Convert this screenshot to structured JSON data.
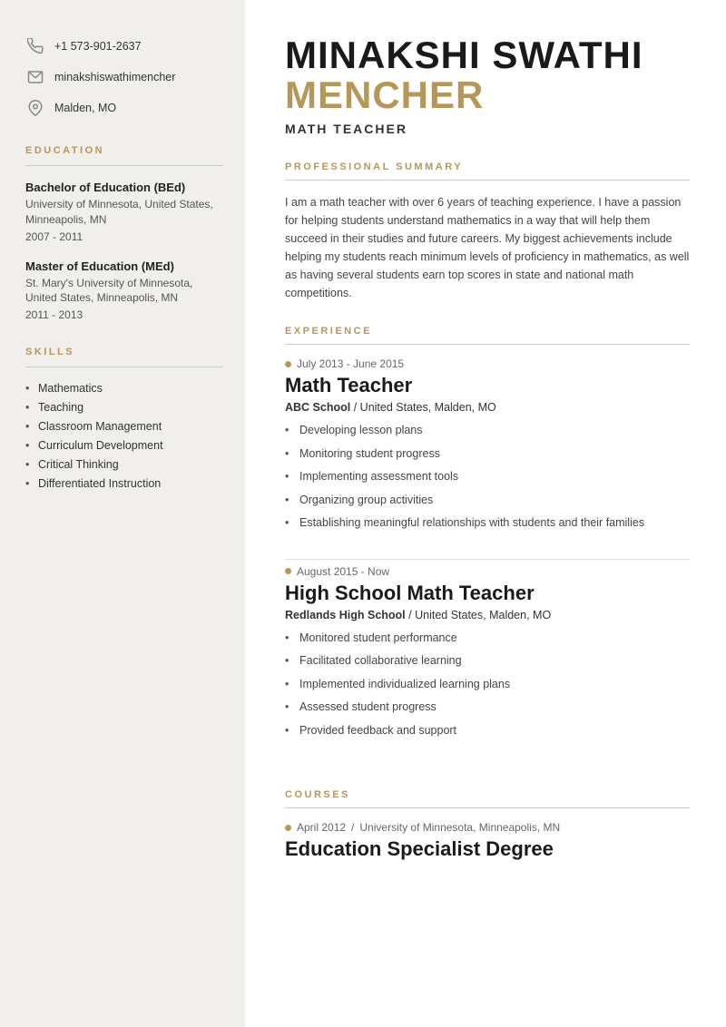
{
  "sidebar": {
    "contact": {
      "phone": "+1 573-901-2637",
      "email": "minakshiswathimencher",
      "location": "Malden, MO"
    },
    "education_title": "EDUCATION",
    "education": [
      {
        "degree": "Bachelor of Education (BEd)",
        "school": "University of Minnesota, United States, Minneapolis, MN",
        "years": "2007 - 2011"
      },
      {
        "degree": "Master of Education (MEd)",
        "school": "St. Mary's University of Minnesota, United States, Minneapolis, MN",
        "years": "2011 - 2013"
      }
    ],
    "skills_title": "SKILLS",
    "skills": [
      "Mathematics",
      "Teaching",
      "Classroom Management",
      "Curriculum Development",
      "Critical Thinking",
      "Differentiated Instruction"
    ]
  },
  "main": {
    "name_first": "MINAKSHI SWATHI",
    "name_last": "MENCHER",
    "job_title": "MATH TEACHER",
    "summary_title": "PROFESSIONAL SUMMARY",
    "summary": "I am a math teacher with over 6 years of teaching experience. I have a passion for helping students understand mathematics in a way that will help them succeed in their studies and future careers. My biggest achievements include helping my students reach minimum levels of proficiency in mathematics, as well as having several students earn top scores in state and national math competitions.",
    "experience_title": "EXPERIENCE",
    "experience": [
      {
        "dates": "July 2013 - June 2015",
        "title": "Math Teacher",
        "company": "ABC School",
        "separator": " /  ",
        "location": "United States, Malden, MO",
        "bullets": [
          "Developing lesson plans",
          "Monitoring student progress",
          "Implementing assessment tools",
          "Organizing group activities",
          "Establishing meaningful relationships with students and their families"
        ]
      },
      {
        "dates": "August 2015 - Now",
        "title": "High School Math Teacher",
        "company": "Redlands High School",
        "separator": " /  ",
        "location": "United States, Malden, MO",
        "bullets": [
          "Monitored student performance",
          "Facilitated collaborative learning",
          "Implemented individualized learning plans",
          "Assessed student progress",
          "Provided feedback and support"
        ]
      }
    ],
    "courses_title": "COURSES",
    "courses": [
      {
        "date": "April 2012",
        "institution": "University of Minnesota, Minneapolis, MN",
        "title": "Education Specialist Degree"
      }
    ]
  }
}
